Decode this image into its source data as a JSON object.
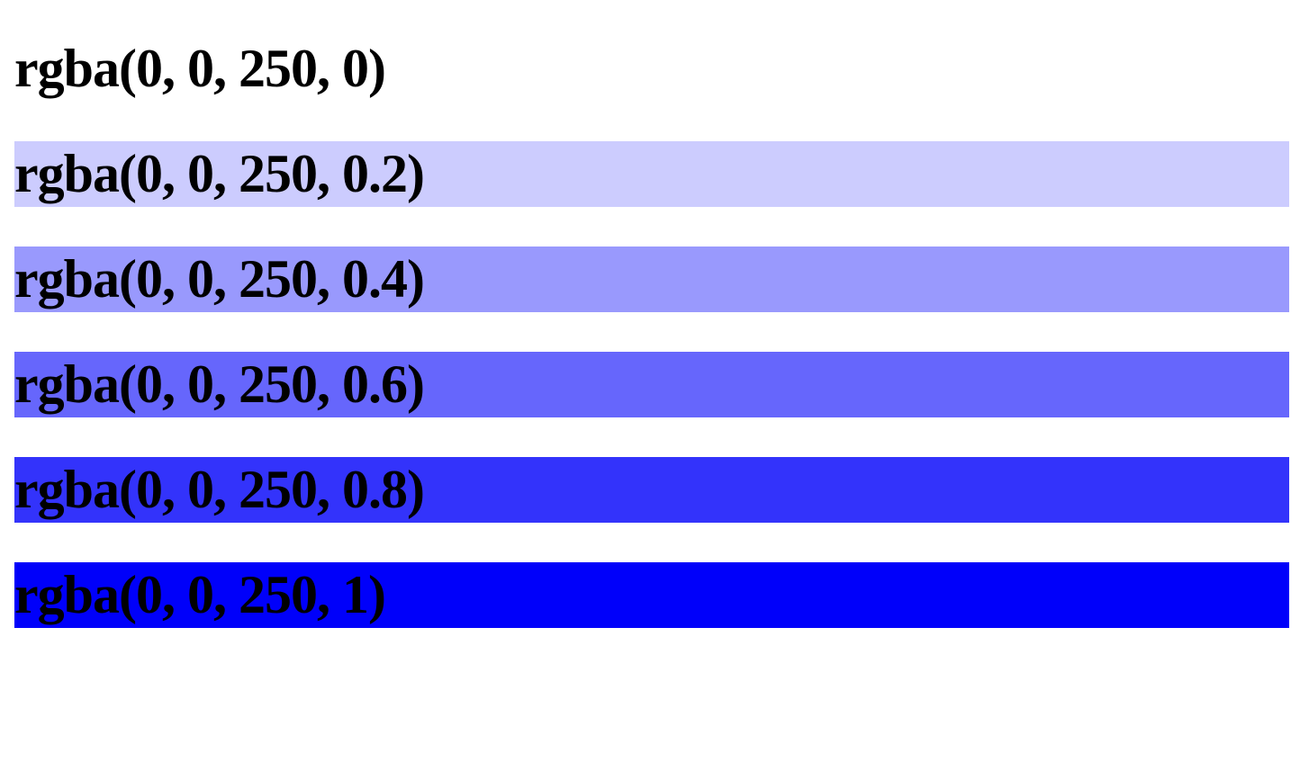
{
  "rows": [
    {
      "label": "rgba(0, 0, 250, 0)",
      "color": "rgba(0, 0, 250, 0)"
    },
    {
      "label": "rgba(0, 0, 250, 0.2)",
      "color": "rgba(0, 0, 250, 0.2)"
    },
    {
      "label": "rgba(0, 0, 250, 0.4)",
      "color": "rgba(0, 0, 250, 0.4)"
    },
    {
      "label": "rgba(0, 0, 250, 0.6)",
      "color": "rgba(0, 0, 250, 0.6)"
    },
    {
      "label": "rgba(0, 0, 250, 0.8)",
      "color": "rgba(0, 0, 250, 0.8)"
    },
    {
      "label": "rgba(0, 0, 250, 1)",
      "color": "rgba(0, 0, 250, 1)"
    }
  ]
}
